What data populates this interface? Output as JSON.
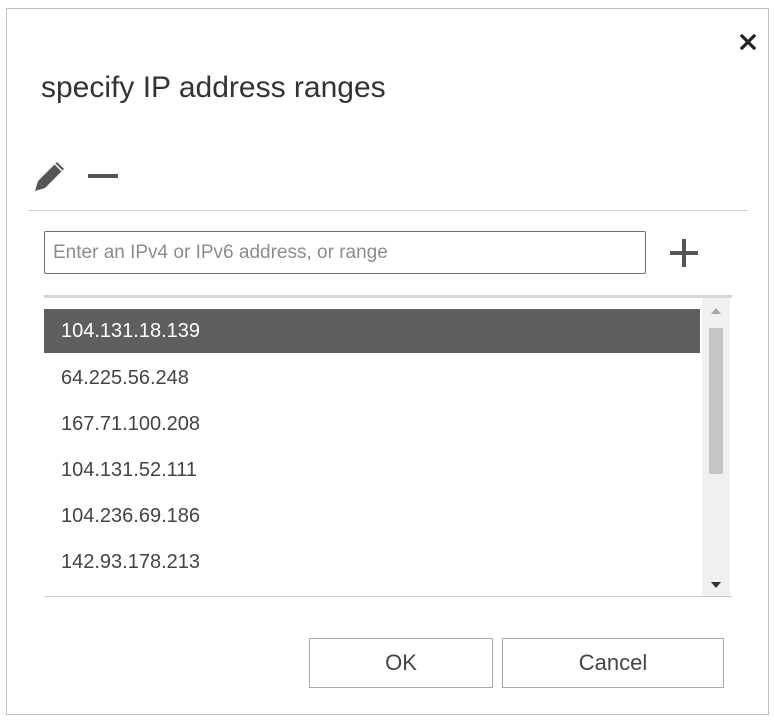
{
  "dialog": {
    "title": "specify IP address ranges",
    "icons": {
      "close": "close-icon",
      "edit": "pencil-icon",
      "remove": "minus-icon",
      "add": "plus-icon"
    }
  },
  "input": {
    "placeholder": "Enter an IPv4 or IPv6 address, or range",
    "value": ""
  },
  "list": {
    "selected_index": 0,
    "items": [
      "104.131.18.139",
      "64.225.56.248",
      "167.71.100.208",
      "104.131.52.111",
      "104.236.69.186",
      "142.93.178.213"
    ]
  },
  "buttons": {
    "ok_label": "OK",
    "cancel_label": "Cancel"
  },
  "colors": {
    "selected_row": "#5f5f5f",
    "border": "#bfbfbf",
    "text": "#333333"
  }
}
